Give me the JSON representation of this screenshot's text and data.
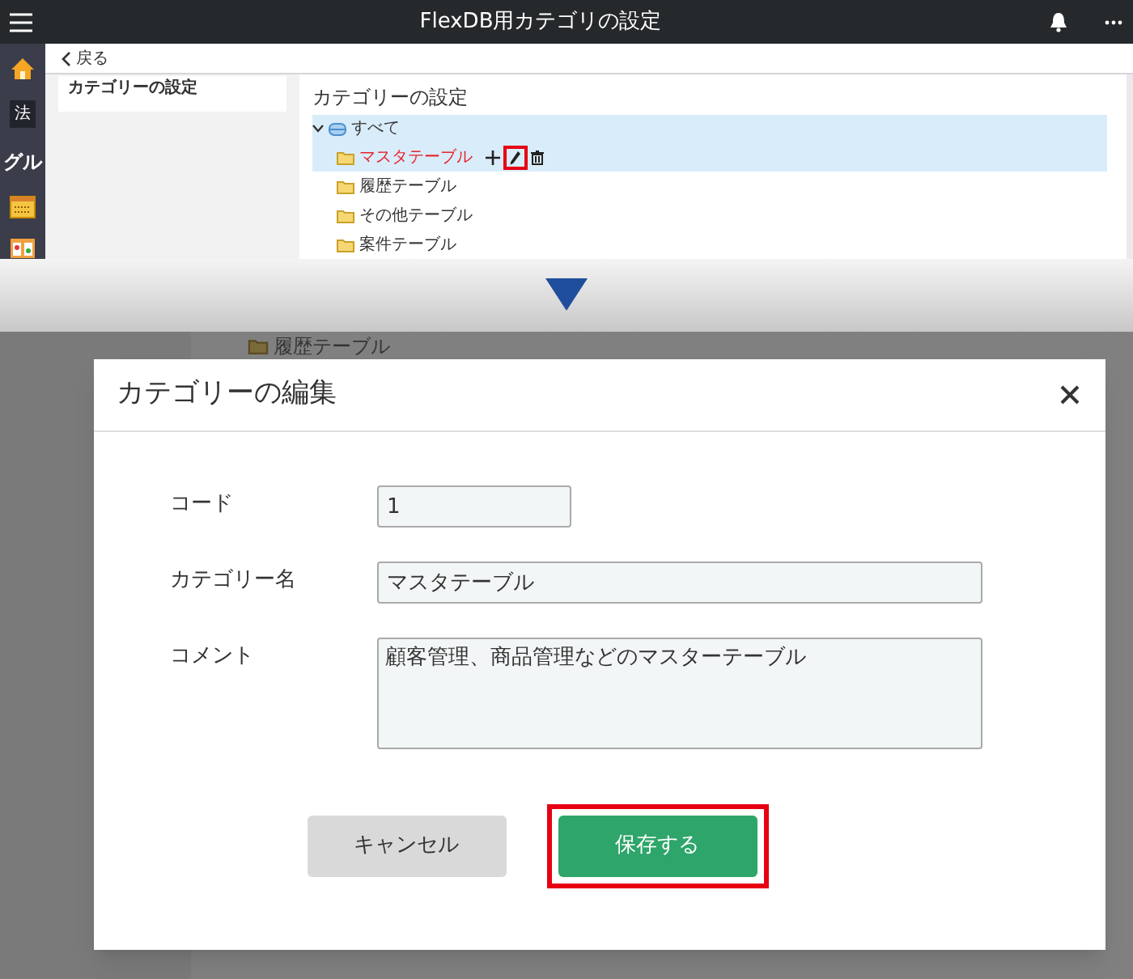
{
  "app": {
    "title": "FlexDB用カテゴリの設定",
    "back": "戻る",
    "sidebar": [
      {
        "kind": "home"
      },
      {
        "kind": "text",
        "label": "法",
        "boxed": true
      },
      {
        "kind": "text",
        "label": "グル",
        "boxed": false
      },
      {
        "kind": "calendar"
      },
      {
        "kind": "photo"
      }
    ],
    "menu_item": "カテゴリーの設定",
    "panel_title": "カテゴリーの設定",
    "tree": [
      {
        "label": "すべて",
        "selected": true,
        "expanded": true,
        "children": [
          {
            "label": "マスタテーブル",
            "selected": true,
            "edit_highlighted": true
          },
          {
            "label": "履歴テーブル",
            "selected": false,
            "edit_highlighted": false
          },
          {
            "label": "その他テーブル",
            "selected": false,
            "edit_highlighted": false
          },
          {
            "label": "案件テーブル",
            "selected": false,
            "edit_highlighted": false
          }
        ]
      }
    ]
  },
  "background_item": "履歴テーブル",
  "dialog": {
    "title": "カテゴリーの編集",
    "fields": [
      {
        "kind": "short",
        "label": "コード",
        "value": "1"
      },
      {
        "kind": "long",
        "label": "カテゴリー名",
        "value": "マスタテーブル"
      },
      {
        "kind": "multiline",
        "label": "コメント",
        "value": "顧客管理、商品管理などのマスターテーブル"
      }
    ],
    "buttons": [
      {
        "kind": "secondary",
        "label": "キャンセル",
        "highlighted": false
      },
      {
        "kind": "primary",
        "label": "保存する",
        "highlighted": true
      }
    ]
  }
}
